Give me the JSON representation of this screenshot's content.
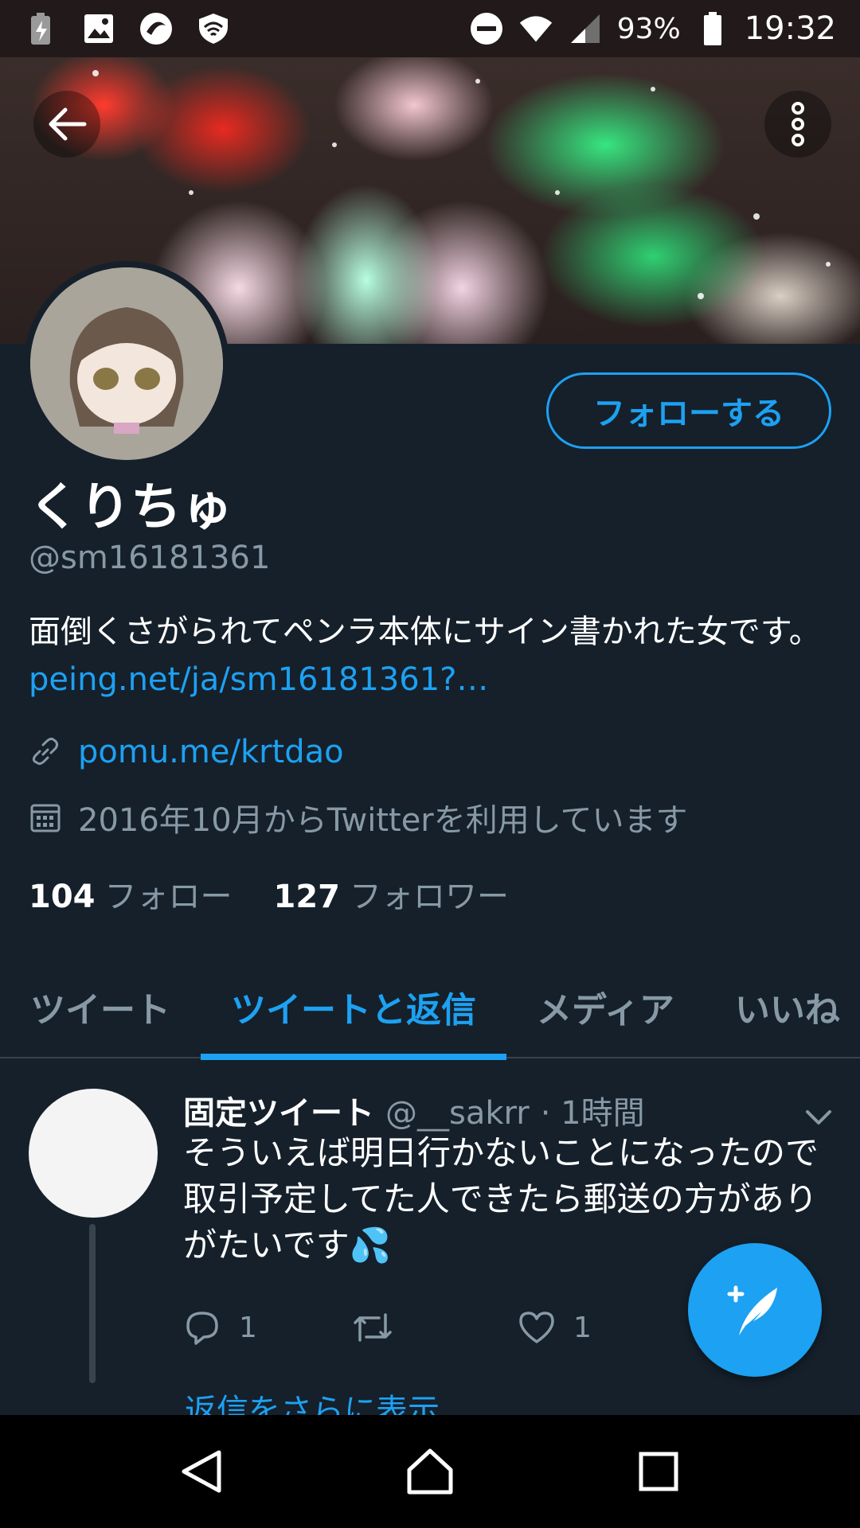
{
  "status_bar": {
    "battery_percent": "93%",
    "time": "19:32"
  },
  "profile": {
    "display_name": "くりちゅ",
    "handle": "@sm16181361",
    "bio_text": "面倒くさがられてペンラ本体にサイン書かれた女です。",
    "bio_link": "peing.net/ja/sm16181361?…",
    "website": "pomu.me/krtdao",
    "joined": "2016年10月からTwitterを利用しています",
    "following_count": "104",
    "following_label": "フォロー",
    "followers_count": "127",
    "followers_label": "フォロワー",
    "follow_button": "フォローする"
  },
  "tabs": [
    {
      "label": "ツイート"
    },
    {
      "label": "ツイートと返信"
    },
    {
      "label": "メディア"
    },
    {
      "label": "いいね"
    }
  ],
  "tweet": {
    "pinned_label": "固定ツイート",
    "handle": "@__sakrr",
    "time": "· 1時間",
    "text": "そういえば明日行かないことになったので取引予定してた人できたら郵送の方がありがたいです💦",
    "reply_count": "1",
    "like_count": "1",
    "more_replies": "返信をさらに表示"
  },
  "icons": {
    "back": "back-arrow-icon",
    "more": "more-vertical-icon",
    "link": "link-icon",
    "calendar": "calendar-icon",
    "reply": "reply-icon",
    "retweet": "retweet-icon",
    "like": "heart-icon",
    "compose": "compose-tweet-icon"
  },
  "colors": {
    "accent": "#1da1f2",
    "background": "#15202b",
    "secondary_text": "#8899a6"
  }
}
